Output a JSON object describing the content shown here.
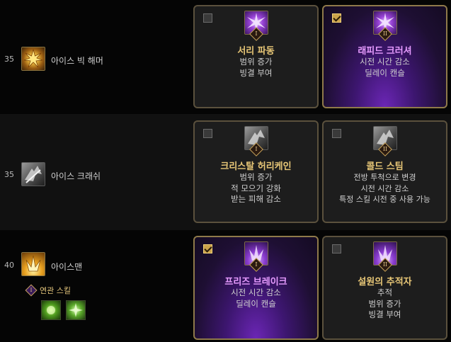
{
  "rows": [
    {
      "level": "35",
      "skill_name": "아이스 빅 해머",
      "skill_icon": "ice-big-hammer-icon",
      "cards": [
        {
          "checked": false,
          "roman": "I",
          "title": "서리 파동",
          "lines": [
            "범위 증가",
            "빙결 부여"
          ]
        },
        {
          "checked": true,
          "roman": "II",
          "title": "래피드 크러셔",
          "lines": [
            "시전 시간 감소",
            "딜레이 캔슬"
          ]
        }
      ]
    },
    {
      "level": "35",
      "skill_name": "아이스 크래쉬",
      "skill_icon": "ice-crash-icon",
      "cards": [
        {
          "checked": false,
          "roman": "I",
          "title": "크리스탈 허리케인",
          "lines": [
            "범위 증가",
            "적 모으기 강화",
            "받는 피해 감소"
          ]
        },
        {
          "checked": false,
          "roman": "II",
          "title": "콜드 스팀",
          "lines": [
            "전방 투척으로 변경",
            "시전 시간 감소",
            "특정 스킬 시전 중 사용 가능"
          ]
        }
      ]
    },
    {
      "level": "40",
      "skill_name": "아이스맨",
      "skill_icon": "iceman-icon",
      "cards": [
        {
          "checked": true,
          "roman": "I",
          "title": "프리즈 브레이크",
          "lines": [
            "시전 시간 감소",
            "딜레이 캔슬"
          ]
        },
        {
          "checked": false,
          "roman": "II",
          "title": "설원의 추적자",
          "lines": [
            "추적",
            "범위 증가",
            "빙결 부여"
          ]
        }
      ],
      "related": {
        "roman": "I",
        "label": "연관 스킬",
        "icons": [
          "related-skill-green-burst-icon",
          "related-skill-green-star-icon"
        ]
      }
    }
  ],
  "colors": {
    "selected_title": "#e79cff",
    "title": "#e8c777",
    "selected_bg": "#6b26b5",
    "card_border": "#6a5a3a",
    "checkbox_on": "#caa24a"
  }
}
